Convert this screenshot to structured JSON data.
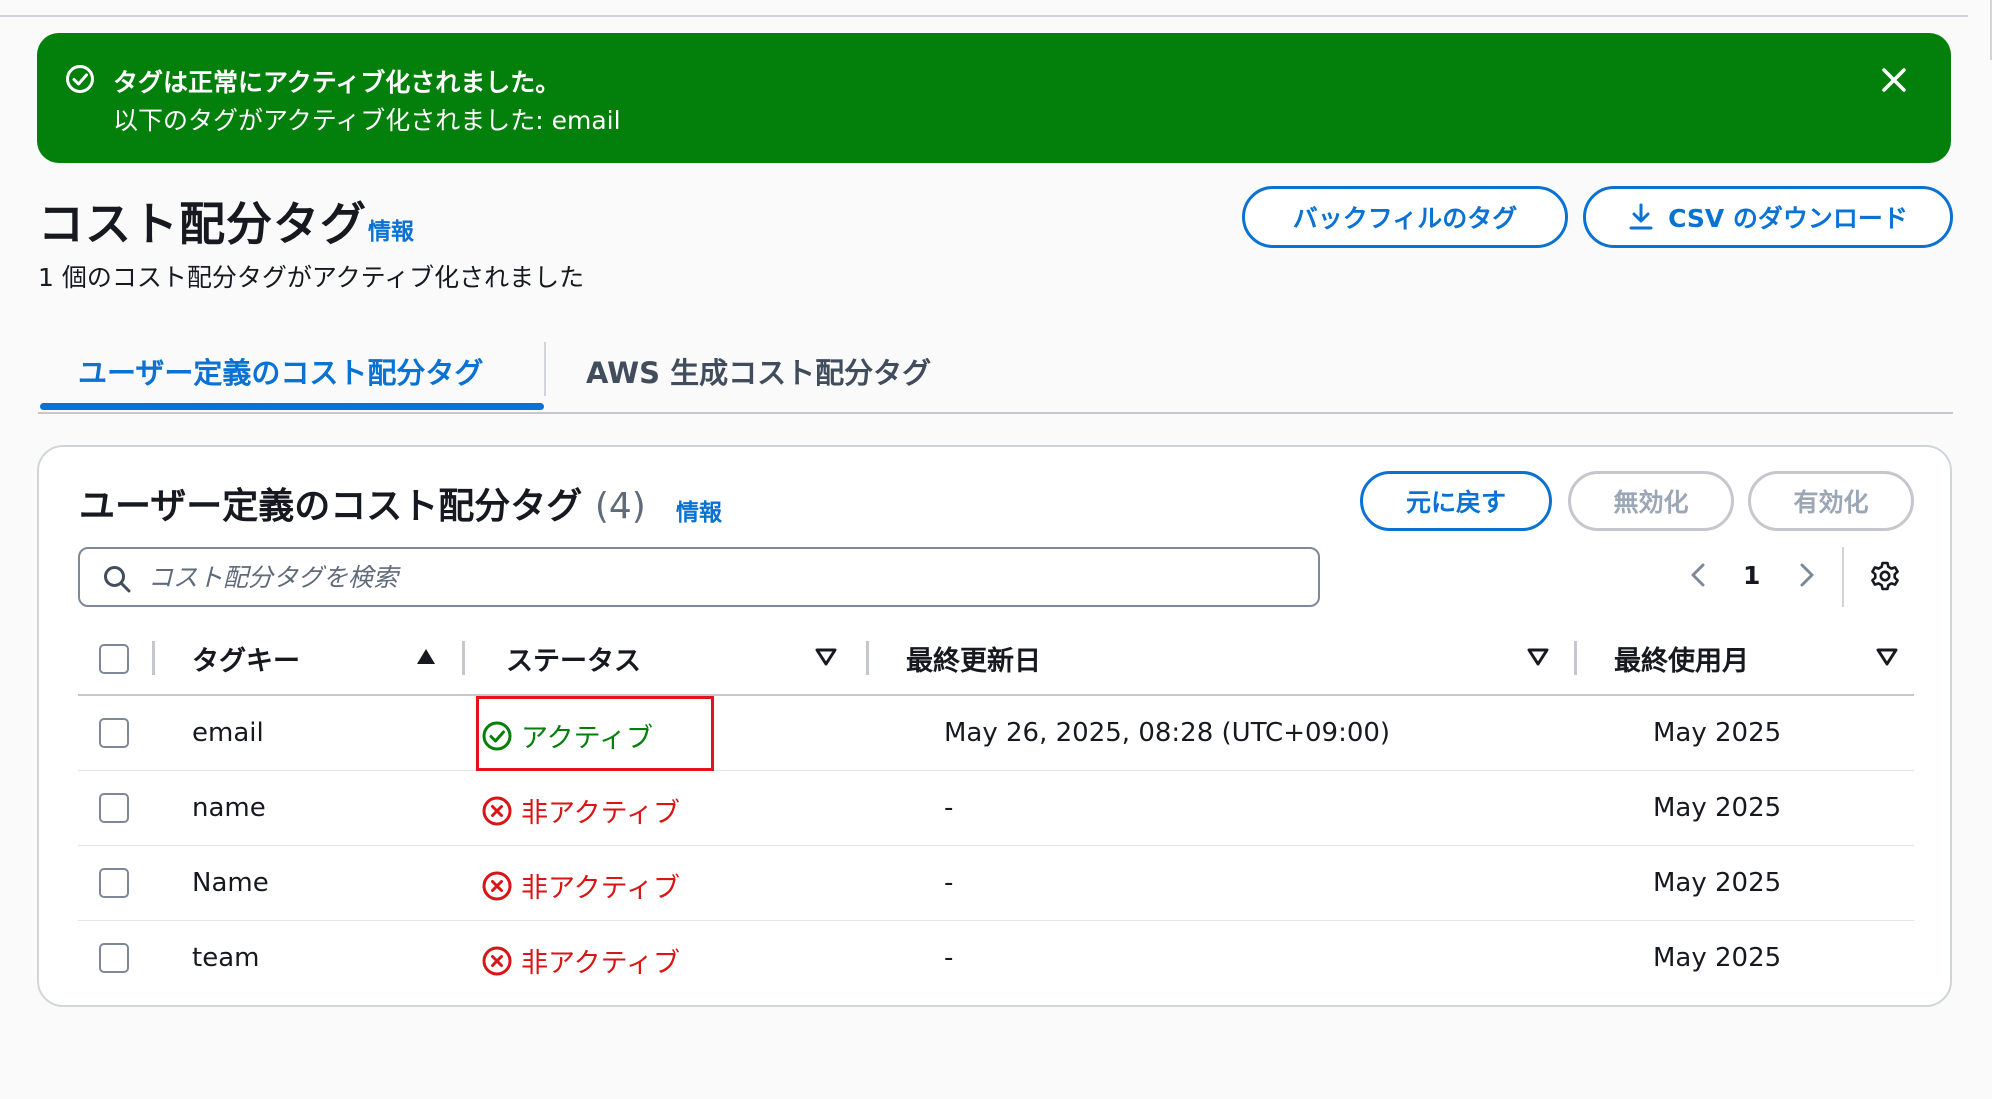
{
  "flash": {
    "title": "タグは正常にアクティブ化されました。",
    "message": "以下のタグがアクティブ化されました: email"
  },
  "header": {
    "title": "コスト配分タグ",
    "info": "情報",
    "subtitle": "1 個のコスト配分タグがアクティブ化されました",
    "backfill_label": "バックフィルのタグ",
    "csv_label": "CSV のダウンロード"
  },
  "tabs": [
    {
      "label": "ユーザー定義のコスト配分タグ",
      "active": true
    },
    {
      "label": "AWS 生成コスト配分タグ",
      "active": false
    }
  ],
  "panel": {
    "title": "ユーザー定義のコスト配分タグ",
    "count": "(4)",
    "info": "情報",
    "revert_label": "元に戻す",
    "disable_label": "無効化",
    "enable_label": "有効化",
    "search_placeholder": "コスト配分タグを検索",
    "page": "1"
  },
  "table": {
    "columns": [
      "タグキー",
      "ステータス",
      "最終更新日",
      "最終使用月"
    ],
    "rows": [
      {
        "key": "email",
        "status": "アクティブ",
        "updated": "May 26, 2025, 08:28 (UTC+09:00)",
        "last_used": "May 2025"
      },
      {
        "key": "name",
        "status": "非アクティブ",
        "updated": "-",
        "last_used": "May 2025"
      },
      {
        "key": "Name",
        "status": "非アクティブ",
        "updated": "-",
        "last_used": "May 2025"
      },
      {
        "key": "team",
        "status": "非アクティブ",
        "updated": "-",
        "last_used": "May 2025"
      }
    ]
  },
  "colors": {
    "flash_success": "#037f0c",
    "link": "#0972d3",
    "status_active": "#037f0c",
    "status_inactive": "#d91515",
    "highlight": "#e3121c"
  }
}
